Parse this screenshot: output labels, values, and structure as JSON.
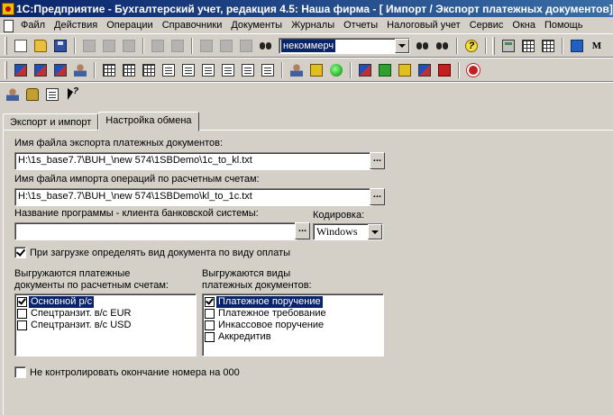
{
  "window": {
    "title": "1С:Предприятие - Бухгалтерский учет, редакция 4.5: Наша фирма - [ Импорт / Экспорт платежных документов]"
  },
  "menu": [
    "Файл",
    "Действия",
    "Операции",
    "Справочники",
    "Документы",
    "Журналы",
    "Отчеты",
    "Налоговый учет",
    "Сервис",
    "Окна",
    "Помощь"
  ],
  "toolbar": {
    "search_value": "некоммерч",
    "right_letter": "M",
    "help_glyph": "?"
  },
  "tabs": [
    {
      "label": "Экспорт и импорт",
      "active": false
    },
    {
      "label": "Настройка обмена",
      "active": true
    }
  ],
  "form": {
    "export_file_label": "Имя файла экспорта платежных документов:",
    "export_file_value": "H:\\1s_base7.7\\BUH_\\new 574\\1SBDemo\\1c_to_kl.txt",
    "import_file_label": "Имя файла импорта операций по расчетным счетам:",
    "import_file_value": "H:\\1s_base7.7\\BUH_\\new 574\\1SBDemo\\kl_to_1c.txt",
    "bank_program_label": "Название программы - клиента банковской системы:",
    "bank_program_value": "",
    "encoding_label": "Кодировка:",
    "encoding_value": "Windows",
    "browse_label": "...",
    "detect_doc_type_label": "При загрузке определять вид документа по виду оплаты",
    "detect_doc_type_checked": true,
    "accounts_label_1": "Выгружаются платежные",
    "accounts_label_2": "документы по расчетным счетам:",
    "accounts": [
      {
        "label": "Основной р/с",
        "checked": true,
        "selected": true
      },
      {
        "label": "Спецтранзит. в/с EUR",
        "checked": false,
        "selected": false
      },
      {
        "label": "Спецтранзит. в/с USD",
        "checked": false,
        "selected": false
      }
    ],
    "doctypes_label_1": "Выгружаются виды",
    "doctypes_label_2": "платежных документов:",
    "doctypes": [
      {
        "label": "Платежное поручение",
        "checked": true,
        "selected": true
      },
      {
        "label": "Платежное требование",
        "checked": false,
        "selected": false
      },
      {
        "label": "Инкассовое поручение",
        "checked": false,
        "selected": false
      },
      {
        "label": "Аккредитив",
        "checked": false,
        "selected": false
      }
    ],
    "no_control_label": "Не контролировать окончание номера на 000",
    "no_control_checked": false
  },
  "colors": {
    "title_active": "#0a246a",
    "face": "#d4d0c8",
    "selection": "#0a246a"
  }
}
